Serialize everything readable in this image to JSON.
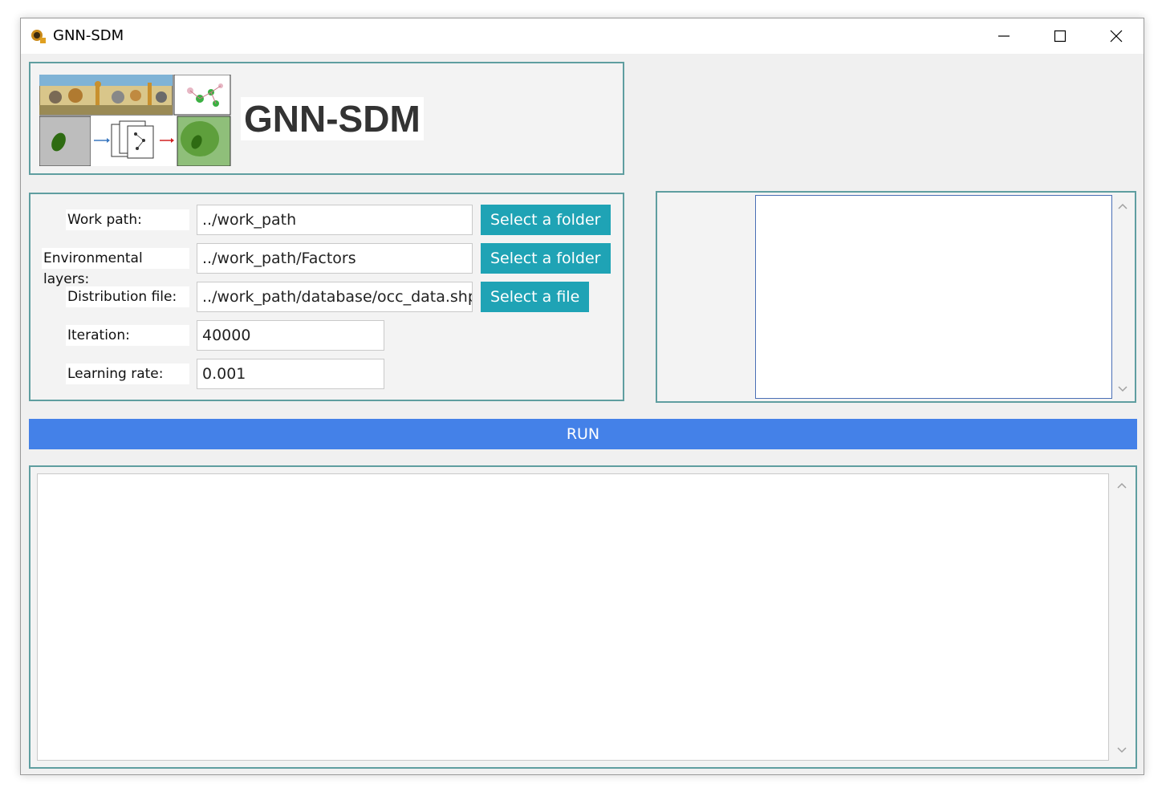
{
  "window": {
    "title": "GNN-SDM",
    "controls": [
      "minimize-icon",
      "maximize-icon",
      "close-icon"
    ]
  },
  "banner": {
    "title": "GNN-SDM",
    "image": "gnn-sdm-workflow-graphic"
  },
  "form": {
    "fields": [
      {
        "label": "Work path:",
        "value": "../work_path",
        "button": "Select a folder"
      },
      {
        "label": "Environmental layers:",
        "value": "../work_path/Factors",
        "button": "Select a folder"
      },
      {
        "label": "Distribution file:",
        "value": "../work_path/database/occ_data.shp",
        "button": "Select a file"
      },
      {
        "label": "Iteration:",
        "value": "40000"
      },
      {
        "label": "Learning rate:",
        "value": "0.001"
      }
    ]
  },
  "run": {
    "label": "RUN"
  },
  "colors": {
    "panel_border": "#5f9ea0",
    "select_button": "#1fa3b5",
    "run_button": "#4481e8"
  }
}
